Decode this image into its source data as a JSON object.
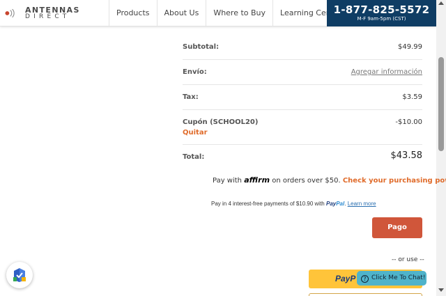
{
  "header": {
    "logo_line1": "ANTENNAS",
    "logo_line2": "DIRECT",
    "nav": [
      "Products",
      "About Us",
      "Where to Buy",
      "Learning Center"
    ],
    "phone": "1-877-825-5572",
    "hours": "M-F 9am-5pm (CST)"
  },
  "summary": {
    "subtotal_label": "Subtotal:",
    "subtotal_value": "$49.99",
    "shipping_label": "Envío:",
    "shipping_value": "Agregar información",
    "tax_label": "Tax:",
    "tax_value": "$3.59",
    "coupon_label": "Cupón (SCHOOL20)",
    "coupon_remove": "Quitar",
    "coupon_value": "-$10.00",
    "total_label": "Total:",
    "total_value": "$43.58"
  },
  "affirm": {
    "pre": "Pay with ",
    "brand": "affirm",
    "mid": " on orders over $50. ",
    "link": "Check your purchasing power"
  },
  "paypal_line": {
    "text": "Pay in 4 interest-free payments of $10.90 with ",
    "brand1": "Pay",
    "brand2": "Pal",
    "learn": "Learn more"
  },
  "pago_button": "Pago",
  "or_use": "-- or use --",
  "paypal_button": "PayP",
  "chat": "Click Me To Chat!",
  "colors": {
    "accent": "#e06b2a",
    "navy": "#0f3d64",
    "pago": "#d0563a",
    "paypal_yellow": "#ffc43a",
    "chat": "#4fb3ca"
  }
}
